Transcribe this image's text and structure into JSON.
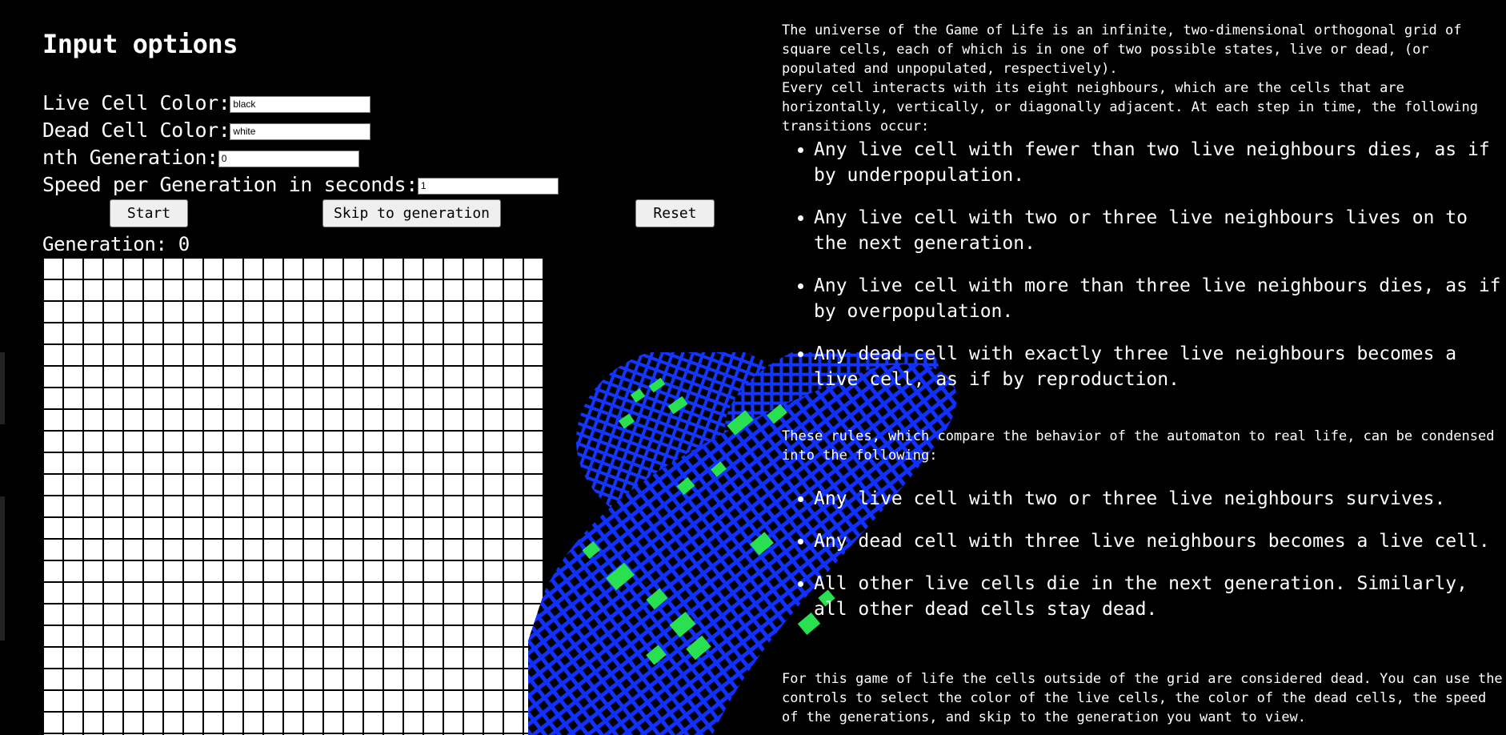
{
  "options": {
    "title": "Input options",
    "live_color_label": "Live Cell Color:",
    "live_color_value": "black",
    "dead_color_label": "Dead Cell Color:",
    "dead_color_value": "white",
    "nth_generation_label": "nth Generation:",
    "nth_generation_value": "0",
    "speed_label": "Speed per Generation in seconds:",
    "speed_value": "1"
  },
  "buttons": {
    "start": "Start",
    "skip": "Skip to generation",
    "reset": "Reset"
  },
  "generation": {
    "label": "Generation: 0"
  },
  "grid": {
    "live_color": "#000000",
    "dead_color": "#ffffff"
  },
  "description": {
    "intro": "The universe of the Game of Life is an infinite, two-dimensional orthogonal grid of square cells, each of which is in one of two possible states, live or dead, (or populated and unpopulated, respectively).",
    "neighbours": "Every cell interacts with its eight neighbours, which are the cells that are horizontally, vertically, or diagonally adjacent. At each step in time, the following transitions occur:",
    "rules": [
      "Any live cell with fewer than two live neighbours dies, as if by underpopulation.",
      "Any live cell with two or three live neighbours lives on to the next generation.",
      "Any live cell with more than three live neighbours dies, as if by overpopulation.",
      "Any dead cell with exactly three live neighbours becomes a live cell, as if by reproduction."
    ],
    "condensed_intro": "These rules, which compare the behavior of the automaton to real life, can be condensed into the following:",
    "condensed_rules": [
      "Any live cell with two or three live neighbours survives.",
      "Any dead cell with three live neighbours becomes a live cell.",
      "All other live cells die in the next generation. Similarly, all other dead cells stay dead."
    ],
    "footer": "For this game of life the cells outside of the grid are considered dead. You can use the controls to select the color of the live cells, the color of the dead cells, the speed of the generations, and skip to the generation you want to view."
  },
  "background_art": {
    "mesh_color": "#1030ff",
    "highlight_color": "#28e050"
  }
}
